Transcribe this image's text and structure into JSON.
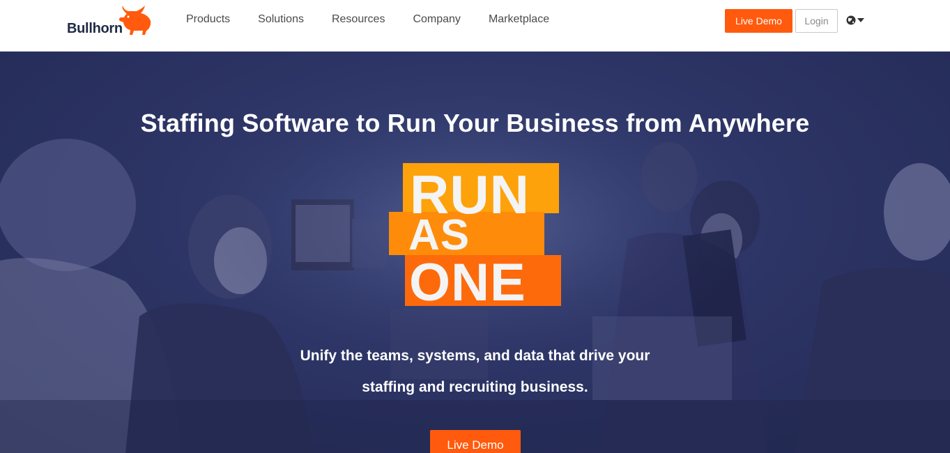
{
  "brand": {
    "name": "Bullhorn",
    "logo_icon": "bull-icon",
    "accent": "#ff5a0d"
  },
  "nav": {
    "items": [
      {
        "label": "Products"
      },
      {
        "label": "Solutions"
      },
      {
        "label": "Resources"
      },
      {
        "label": "Company"
      },
      {
        "label": "Marketplace"
      }
    ]
  },
  "header_actions": {
    "live_demo": "Live Demo",
    "login": "Login",
    "language_icon": "globe-icon"
  },
  "hero": {
    "title": "Staffing Software to Run Your Business from Anywhere",
    "tagline": {
      "line1": "RUN",
      "line2": "AS",
      "line3": "ONE",
      "colors": [
        "#fda20a",
        "#fe8c0a",
        "#fd6a0c"
      ]
    },
    "subtitle_line1": "Unify the teams, systems, and data that drive your",
    "subtitle_line2": "staffing and recruiting business.",
    "cta": "Live Demo",
    "background_color": "#2d3566"
  }
}
